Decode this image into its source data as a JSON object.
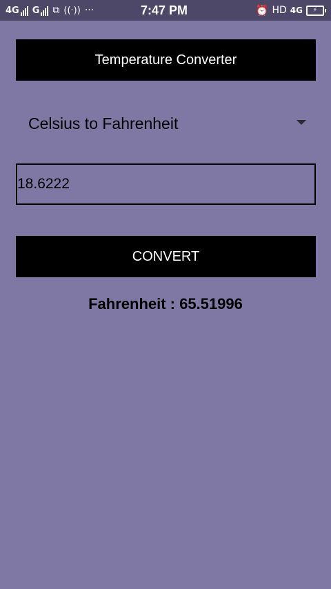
{
  "status_bar": {
    "net1": "4G",
    "net2": "G",
    "time": "7:47 PM",
    "hd": "HD",
    "net3": "4G"
  },
  "app": {
    "title": "Temperature Converter",
    "spinner_selected": "Celsius to Fahrenheit",
    "input_value": "18.6222",
    "convert_label": "CONVERT",
    "result_text": "Fahrenheit : 65.51996"
  },
  "colors": {
    "background": "#7F78A4",
    "status_bar": "#4E4868",
    "panel": "#000000"
  }
}
